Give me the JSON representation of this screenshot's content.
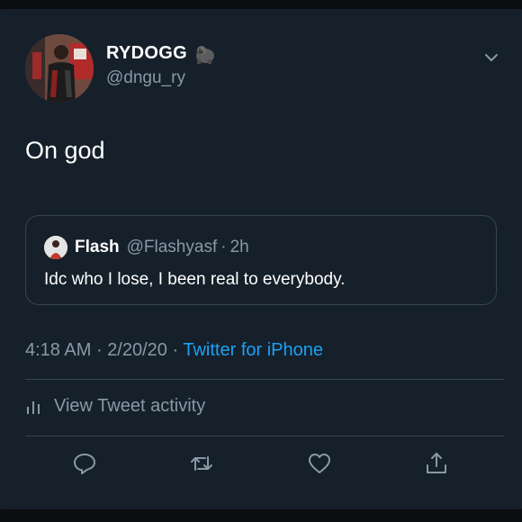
{
  "tweet": {
    "display_name": "RYDOGG",
    "name_emoji": "gorilla-icon",
    "handle": "@dngu_ry",
    "text": "On god",
    "timestamp": "4:18 AM",
    "date": "2/20/20",
    "separator": "·",
    "source": "Twitter for iPhone",
    "activity_label": "View Tweet activity"
  },
  "quoted_tweet": {
    "name": "Flash",
    "handle": "@Flashyasf",
    "separator": "·",
    "time": "2h",
    "text": "Idc who I lose, I been real to everybody."
  },
  "actions": [
    "reply-icon",
    "retweet-icon",
    "like-icon",
    "share-icon"
  ],
  "colors": {
    "background": "#15202b",
    "text": "#ffffff",
    "muted": "#8899a6",
    "link": "#1da1f2",
    "border": "#38444d"
  }
}
